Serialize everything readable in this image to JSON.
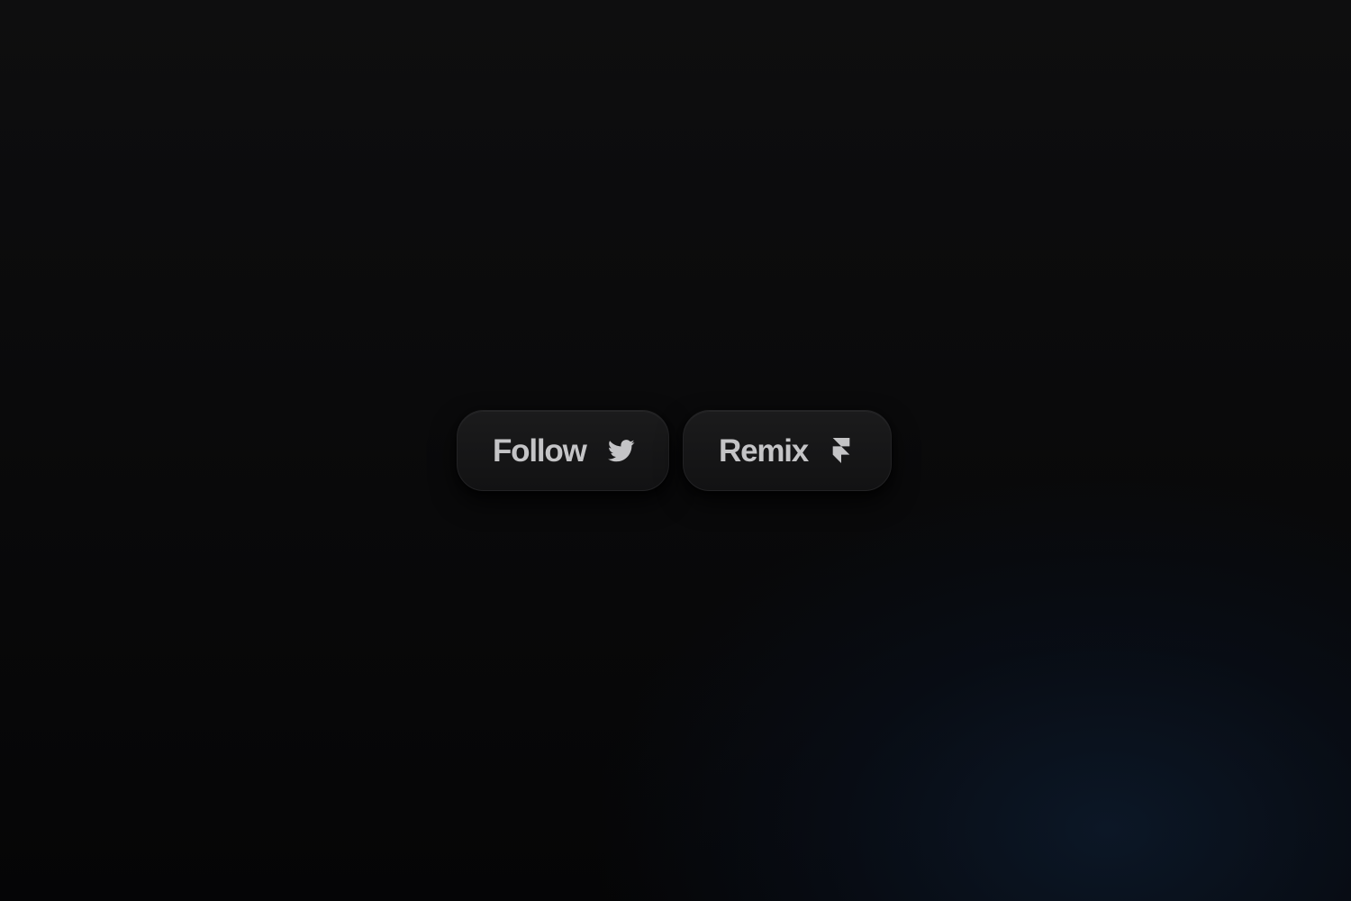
{
  "buttons": {
    "follow": {
      "label": "Follow",
      "icon": "twitter-bird-icon"
    },
    "remix": {
      "label": "Remix",
      "icon": "framer-logo-icon"
    }
  },
  "colors": {
    "background": "#0b0b0c",
    "button_surface": "#161617",
    "text": "#c4c4c6",
    "glow": "#0c1828"
  }
}
